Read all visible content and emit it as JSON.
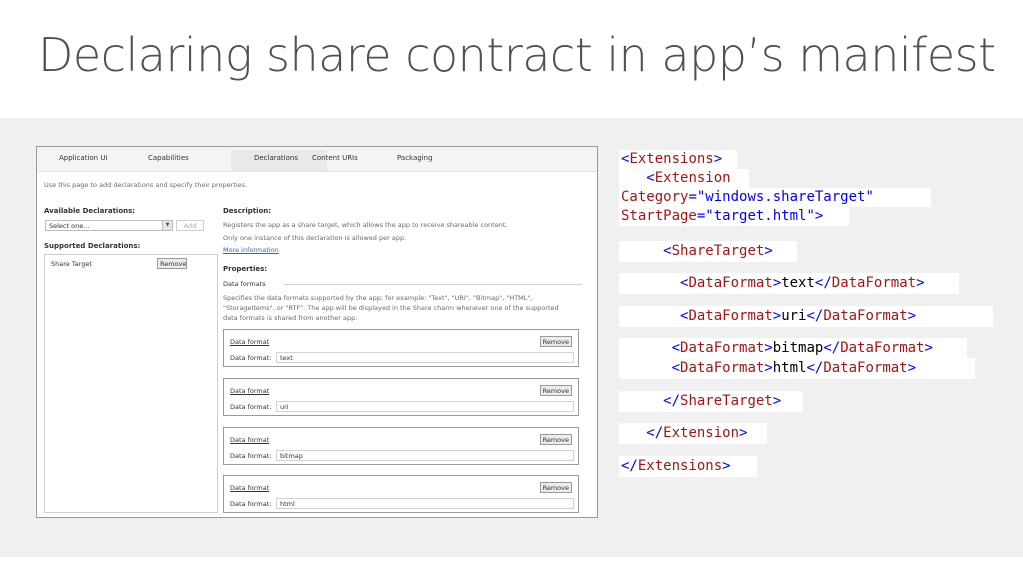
{
  "slide": {
    "title": "Declaring share contract in app’s manifest"
  },
  "tabs": [
    "Application UI",
    "Capabilities",
    "Declarations",
    "Content URIs",
    "Packaging"
  ],
  "intro": "Use this page to add declarations and specify their properties.",
  "available": {
    "label": "Available Declarations:",
    "select_value": "Select one...",
    "add_label": "Add"
  },
  "supported": {
    "label": "Supported Declarations:",
    "item": "Share Target",
    "remove_label": "Remove"
  },
  "description": {
    "label": "Description:",
    "line1": "Registers the app as a share target, which allows the app to receive shareable content.",
    "line2": "Only one instance of this declaration is allowed per app.",
    "more": "More information"
  },
  "properties": {
    "label": "Properties:",
    "section": "Data formats",
    "help1": "Specifies the data formats supported by the app; for example: \"Text\", \"URI\", \"Bitmap\", \"HTML\",",
    "help2": "\"StorageItems\", or \"RTF\". The app will be displayed in the Share charm whenever one of the supported",
    "help3": "data formats is shared from another app."
  },
  "formats": [
    {
      "title": "Data format",
      "field_label": "Data format:",
      "value": "text",
      "remove": "Remove"
    },
    {
      "title": "Data format",
      "field_label": "Data format:",
      "value": "uri",
      "remove": "Remove"
    },
    {
      "title": "Data format",
      "field_label": "Data format:",
      "value": "bitmap",
      "remove": "Remove"
    },
    {
      "title": "Data format",
      "field_label": "Data format:",
      "value": "html",
      "remove": "Remove"
    }
  ],
  "code": {
    "extensions_tag": "Extensions",
    "extension_tag": "Extension",
    "attr_category": "Category",
    "val_category": "\"windows.shareTarget\"",
    "attr_startpage": "StartPage",
    "val_startpage": "\"target.html\"",
    "sharetarget_tag": "ShareTarget",
    "dataformat_tag": "DataFormat",
    "df_values": [
      "text",
      "uri",
      "bitmap",
      "html"
    ]
  },
  "colors": {
    "tag": "#a31515",
    "punctuation": "#0000ff",
    "band": "#f0f0f0",
    "title": "#505050",
    "link": "#2a6ebb"
  }
}
